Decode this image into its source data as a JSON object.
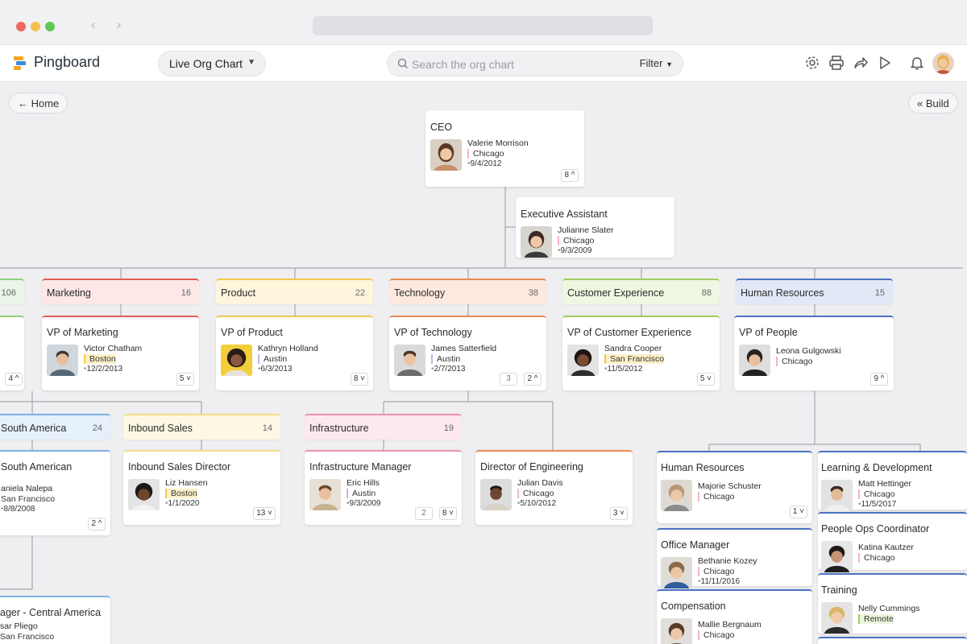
{
  "app": {
    "brand": "Pingboard",
    "view_label": "Live Org Chart",
    "search_placeholder": "Search the org chart",
    "filter_label": "Filter",
    "home_label": "← Home",
    "build_label": "« Build"
  },
  "colors": {
    "marketing": "#e45b5b",
    "product": "#f2c94c",
    "technology": "#ec8a57",
    "customer_experience": "#9fcf5c",
    "human_resources": "#4a72c2",
    "inbound_sales": "#f3dd86",
    "infrastructure": "#ef8fb0",
    "south_america": "#7fb2e6"
  },
  "ceo": {
    "role": "CEO",
    "name": "Valerie Morrison",
    "location": "Chicago",
    "date": "9/4/2012",
    "count": "8"
  },
  "assistant": {
    "role": "Executive Assistant",
    "name": "Julianne Slater",
    "location": "Chicago",
    "date": "9/3/2009"
  },
  "departments": {
    "left_stub": {
      "count": "106"
    },
    "marketing": {
      "label": "Marketing",
      "count": "16"
    },
    "product": {
      "label": "Product",
      "count": "22"
    },
    "technology": {
      "label": "Technology",
      "count": "38"
    },
    "cx": {
      "label": "Customer Experience",
      "count": "88"
    },
    "hr": {
      "label": "Human Resources",
      "count": "15"
    },
    "south_america": {
      "label": "South America",
      "count": "24"
    },
    "inbound_sales": {
      "label": "Inbound Sales",
      "count": "14"
    },
    "infrastructure": {
      "label": "Infrastructure",
      "count": "19"
    }
  },
  "vps": {
    "left_stub": {
      "count": "4"
    },
    "marketing": {
      "role": "VP of Marketing",
      "name": "Victor Chatham",
      "location": "Boston",
      "date": "12/2/2013",
      "count": "5"
    },
    "product": {
      "role": "VP of Product",
      "name": "Kathryn Holland",
      "location": "Austin",
      "date": "6/3/2013",
      "count": "8"
    },
    "technology": {
      "role": "VP of Technology",
      "name": "James Satterfield",
      "location": "Austin",
      "date": "2/7/2013",
      "count_a": "3",
      "count": "2"
    },
    "cx": {
      "role": "VP of Customer Experience",
      "name": "Sandra Cooper",
      "location": "San Francisco",
      "date": "11/5/2012",
      "count": "5"
    },
    "people": {
      "role": "VP of People",
      "name": "Leona Gulgowski",
      "location": "Chicago",
      "count": "9"
    }
  },
  "row3": {
    "south_american": {
      "role": "South American",
      "name": "aniela Nalepa",
      "location": "San Francisco",
      "date": "8/8/2008",
      "count": "2"
    },
    "inbound_sales_director": {
      "role": "Inbound Sales Director",
      "name": "Liz Hansen",
      "location": "Boston",
      "date": "1/1/2020",
      "count": "13"
    },
    "infrastructure_manager": {
      "role": "Infrastructure Manager",
      "name": "Eric Hills",
      "location": "Austin",
      "date": "9/3/2009",
      "count_a": "2",
      "count": "8"
    },
    "director_engineering": {
      "role": "Director of Engineering",
      "name": "Julian Davis",
      "location": "Chicago",
      "date": "5/10/2012",
      "count": "3"
    }
  },
  "hr_team": {
    "human_resources": {
      "role": "Human Resources",
      "name": "Majorie Schuster",
      "location": "Chicago",
      "count": "1"
    },
    "learning": {
      "role": "Learning & Development",
      "name": "Matt Hettinger",
      "location": "Chicago",
      "date": "11/5/2017"
    },
    "office_manager": {
      "role": "Office Manager",
      "name": "Bethanie Kozey",
      "location": "Chicago",
      "date": "11/11/2016"
    },
    "people_ops": {
      "role": "People Ops Coordinator",
      "name": "Katina Kautzer",
      "location": "Chicago"
    },
    "compensation": {
      "role": "Compensation",
      "name": "Mallie Bergnaum",
      "location": "Chicago"
    },
    "training": {
      "role": "Training",
      "name": "Nelly Cummings",
      "location": "Remote"
    }
  },
  "bottom_left": {
    "role": "ager - Central America",
    "name": "sar Pliego",
    "location": "San Francisco"
  }
}
